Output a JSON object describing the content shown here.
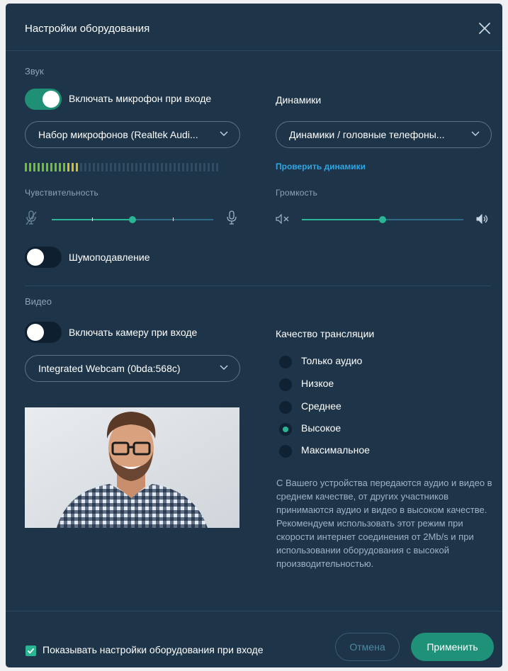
{
  "dialog": {
    "title": "Настройки оборудования"
  },
  "sound": {
    "section_label": "Звук",
    "mic_toggle_label": "Включать микрофон при входе",
    "mic_toggle_on": true,
    "mic_select_value": "Набор микрофонов (Realtek Audi...",
    "speakers_label": "Динамики",
    "speakers_select_value": "Динамики / головные телефоны...",
    "check_speakers_link": "Проверить динамики",
    "sensitivity_label": "Чувствительность",
    "sensitivity_level": 0.5,
    "volume_label": "Громкость",
    "volume_level": 0.5,
    "mic_level_active_bars": 13,
    "noise_suppression_label": "Шумоподавление",
    "noise_suppression_on": false
  },
  "video": {
    "section_label": "Видео",
    "camera_toggle_label": "Включать камеру при входе",
    "camera_toggle_on": false,
    "camera_select_value": "Integrated Webcam (0bda:568c)",
    "quality_label": "Качество трансляции",
    "quality_options": [
      {
        "label": "Только аудио",
        "selected": false
      },
      {
        "label": "Низкое",
        "selected": false
      },
      {
        "label": "Среднее",
        "selected": false
      },
      {
        "label": "Высокое",
        "selected": true
      },
      {
        "label": "Максимальное",
        "selected": false
      }
    ],
    "quality_description": "С Вашего устройства передаются аудио и видео в среднем качестве, от других участников принимаются аудио и видео в высоком качестве. Рекомендуем использовать этот режим при скорости интернет соединения от 2Mb/s и при использовании оборудования с высокой производительностью."
  },
  "footer": {
    "show_on_entry_label": "Показывать настройки оборудования при входе",
    "show_on_entry_checked": true,
    "cancel_label": "Отмена",
    "apply_label": "Применить"
  },
  "colors": {
    "background": "#1d3449",
    "accent": "#2ab694",
    "link": "#2fa6e3"
  }
}
